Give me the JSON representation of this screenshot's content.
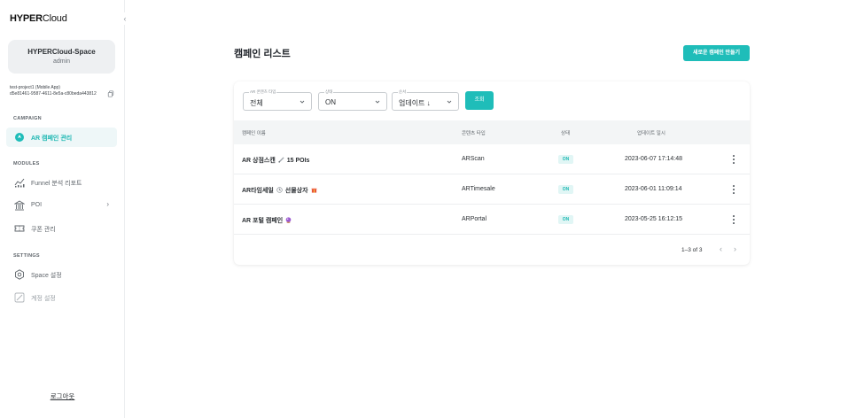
{
  "sidebar": {
    "logo_bold": "HYPER",
    "logo_light": "Cloud",
    "collapse_glyph": "‹",
    "space_name": "HYPERCloud-Space",
    "space_role": "admin",
    "project_name": "test-project1 (Mobile App)",
    "project_id": "d5e81461-9587-4611-8e5a-c80beda443812",
    "section_campaign": "CAMPAIGN",
    "section_modules": "MODULES",
    "section_settings": "SETTINGS",
    "items": [
      {
        "label": "AR 캠페인 관리",
        "icon": "ar-campaign-icon"
      },
      {
        "label": "Funnel 분석 리포트",
        "icon": "chart-icon"
      },
      {
        "label": "POI",
        "icon": "building-icon"
      },
      {
        "label": "쿠폰 관리",
        "icon": "coupon-icon"
      },
      {
        "label": "Space 설정",
        "icon": "gear-icon"
      },
      {
        "label": "계정 설정",
        "icon": "pencil-icon"
      }
    ],
    "poi_chevron": "›",
    "logout": "로그아웃"
  },
  "main": {
    "title": "캠페인 리스트",
    "create_button": "새로운 캠페인 만들기",
    "filters": {
      "content_type_label": "AR 콘텐츠 타입",
      "content_type_value": "전체",
      "status_label": "상태",
      "status_value": "ON",
      "order_label": "순서",
      "order_value": "업데이트 ↓",
      "search_button": "조회"
    },
    "table": {
      "headers": [
        "캠페인 이름",
        "콘텐츠 타입",
        "상태",
        "업데이트 일시"
      ],
      "rows": [
        {
          "name": "AR 상점스캔",
          "suffix": "15 POIs",
          "emoji": "pen-icon",
          "type": "ARScan",
          "status": "ON",
          "updated": "2023-06-07 17:14:48"
        },
        {
          "name": "AR타임세일",
          "suffix": "선물상자",
          "emoji": "clock-icon",
          "emoji2": "gift-icon",
          "type": "ARTimesale",
          "status": "ON",
          "updated": "2023-06-01 11:09:14"
        },
        {
          "name": "AR 포털 캠페인",
          "suffix": "",
          "emoji": "crystal-ball-icon",
          "type": "ARPortal",
          "status": "ON",
          "updated": "2023-05-25 16:12:15"
        }
      ]
    },
    "pagination": {
      "text": "1–3 of 3",
      "prev": "‹",
      "next": "›"
    }
  },
  "colors": {
    "accent": "#1fbdb9",
    "active_bg": "#eef7f8",
    "badge_bg": "#e1f6f5"
  }
}
